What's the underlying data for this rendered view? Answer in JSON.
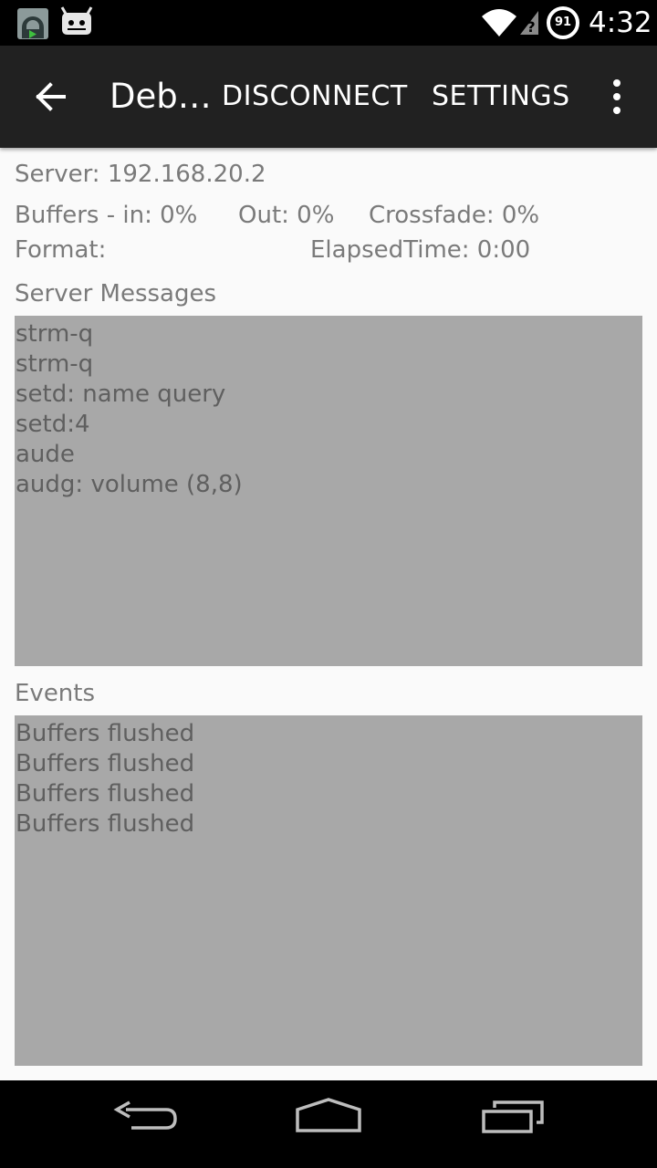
{
  "status_bar": {
    "time": "4:32",
    "battery_level": "91",
    "icons": [
      "app-notification-icon",
      "cyanogenmod-icon",
      "wifi-icon",
      "no-sim-signal-icon",
      "battery-icon"
    ]
  },
  "toolbar": {
    "title": "Deb…",
    "disconnect_label": "DISCONNECT",
    "settings_label": "SETTINGS",
    "back_icon": "arrow-back-icon",
    "overflow_icon": "more-vert-icon",
    "background": "#212121"
  },
  "info": {
    "server": "Server: 192.168.20.2",
    "buffers_in": "Buffers - in:  0%",
    "buffers_out": "Out: 0%",
    "crossfade": "Crossfade: 0%",
    "format": "Format:",
    "elapsed_time": "ElapsedTime: 0:00"
  },
  "server_messages": {
    "label": "Server Messages",
    "lines": [
      "strm-q",
      "strm-q",
      "setd: name query",
      "setd:4",
      "aude",
      "audg: volume (8,8)"
    ]
  },
  "events": {
    "label": "Events",
    "lines": [
      "Buffers flushed",
      "Buffers flushed",
      "Buffers flushed",
      "Buffers flushed"
    ]
  },
  "colors": {
    "log_background": "#a8a8a8",
    "text": "#7a7a7a"
  }
}
